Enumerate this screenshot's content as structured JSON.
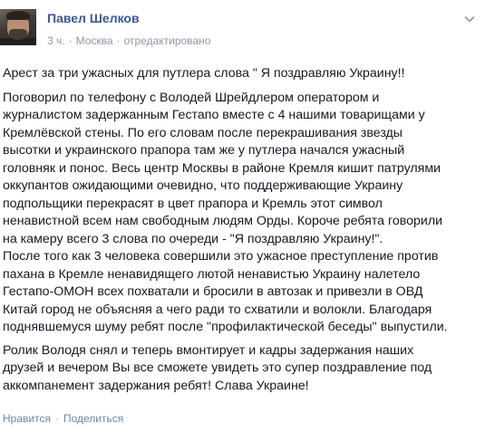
{
  "post": {
    "author": "Павел Шелков",
    "time": "3 ч.",
    "location": "Москва",
    "edited": "отредактировано",
    "separator": "·",
    "paragraphs": [
      "Арест за три ужасных для путлера слова \" Я поздравляю Украину!!",
      "Поговорил по телефону с Володей Шрейдлером оператором и\nжурналистом задержанным Гестапо вместе с 4 нашими товарищами у\nКремлёвской стены. По его словам после перекрашивания звезды\nвысотки и украинского прапора там же у путлера начался ужасный\nголовняк и понос. Весь центр Москвы в районе Кремля кишит патрулями\nоккупантов ожидающими очевидно, что поддерживающие Украину\nподпольщики перекрасят в цвет прапора и Кремль этот символ\nненавистной всем нам свободным людям Орды. Короче ребята говорили\nна камеру всего 3 слова по очереди - \"Я поздравляю Украину!\".\nПосле того как 3 человека совершили это ужасное преступление против\nпахана в Кремле ненавидящего лютой ненавистью Украину налетело\nГестапо-ОМОН всех похватали и бросили в автозак и привезли в ОВД\nКитай город не объясняя а чего ради то схватили и волокли. Благодаря\nподнявшемуся шуму ребят после \"профилактической беседы\" выпустили.",
      "Ролик Володя снял и теперь вмонтирует и кадры задержания наших\nдрузей и вечером Вы все сможете увидеть это супер поздравление под\nаккомпанемент задержания ребят! Слава Украине!"
    ]
  },
  "actions": {
    "like": "Нравится",
    "share": "Поделиться",
    "separator": "·"
  },
  "icons": {
    "menu": "chevron-down-icon",
    "avatar": "profile-photo"
  },
  "colors": {
    "author": "#3b5998",
    "meta": "#9197a3",
    "text": "#141823",
    "action": "#6d84b4"
  }
}
